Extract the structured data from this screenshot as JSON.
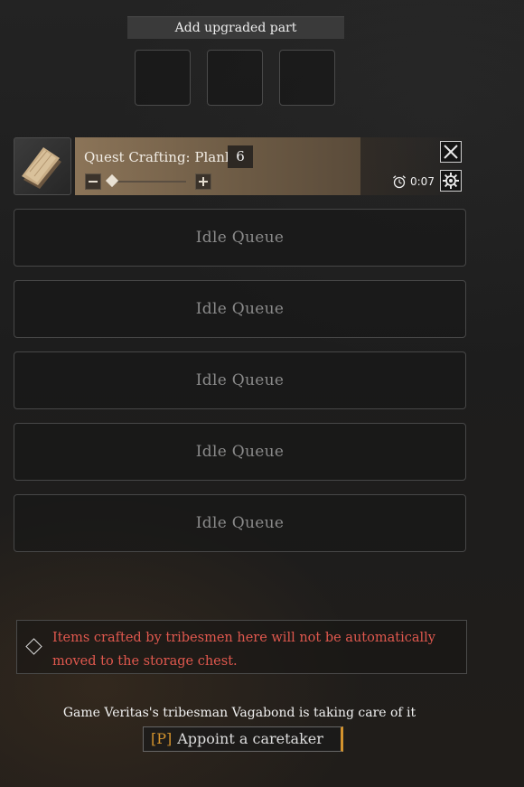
{
  "upgrade": {
    "title": "Add upgraded part",
    "slot_count": 3
  },
  "crafting": {
    "label": "Quest Crafting: Plank",
    "quantity": "6",
    "timer": "0:07",
    "item_icon": "plank-icon",
    "slider_level": 0
  },
  "queues": [
    {
      "label": "Idle Queue"
    },
    {
      "label": "Idle Queue"
    },
    {
      "label": "Idle Queue"
    },
    {
      "label": "Idle Queue"
    },
    {
      "label": "Idle Queue"
    }
  ],
  "notice": {
    "icon": "diamond-icon",
    "text": "Items crafted by tribesmen here will not be automatically moved to the storage chest.",
    "color": "#e0584e"
  },
  "caretaker": {
    "status": "Game Veritas's tribesman Vagabond is taking care of it",
    "hotkey": "[P]",
    "button_label": "Appoint a caretaker",
    "accent": "#d4932d"
  }
}
